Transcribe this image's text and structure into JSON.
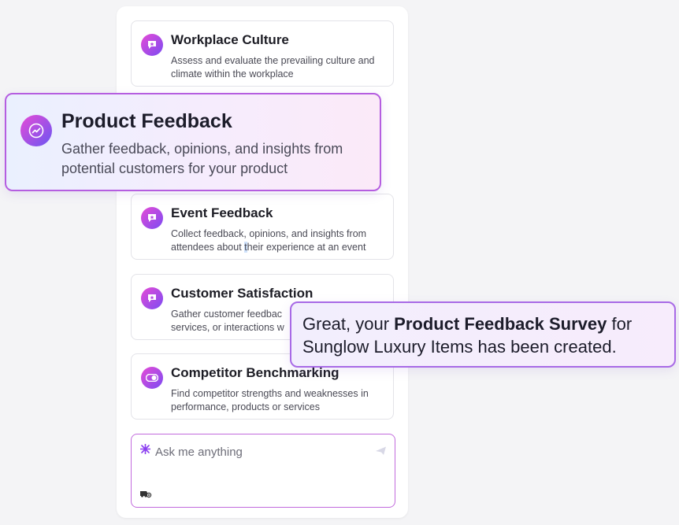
{
  "cards": [
    {
      "title": "Workplace Culture",
      "desc": "Assess and evaluate the prevailing culture and climate within the workplace",
      "icon": "chat-star-icon"
    },
    {
      "title": "Event Feedback",
      "desc_before": "Collect feedback, opinions, and insights from attendees about ",
      "desc_highlight": "t",
      "desc_after": "heir experience at an event",
      "icon": "chat-star-icon"
    },
    {
      "title": "Customer Satisfaction",
      "desc": "Gather customer feedbac services, or interactions w",
      "icon": "chat-star-icon"
    },
    {
      "title": "Competitor Benchmarking",
      "desc": "Find competitor strengths and weaknesses in performance, products or services",
      "icon": "toggle-icon"
    }
  ],
  "hero": {
    "title": "Product Feedback",
    "desc": "Gather feedback, opinions, and insights from potential customers for your product",
    "icon": "trend-chart-icon"
  },
  "toast": {
    "prefix": "Great, your ",
    "bold": "Product Feedback Survey",
    "suffix": " for Sunglow Luxury Items has been created."
  },
  "ask": {
    "placeholder": "Ask me anything",
    "icon_left": "sparkle-icon",
    "icon_send": "send-icon",
    "icon_attach": "attach-icon"
  },
  "colors": {
    "accent_pink": "#e64bd6",
    "accent_purple": "#7b4bf2",
    "border_purple": "#b55ee0"
  }
}
